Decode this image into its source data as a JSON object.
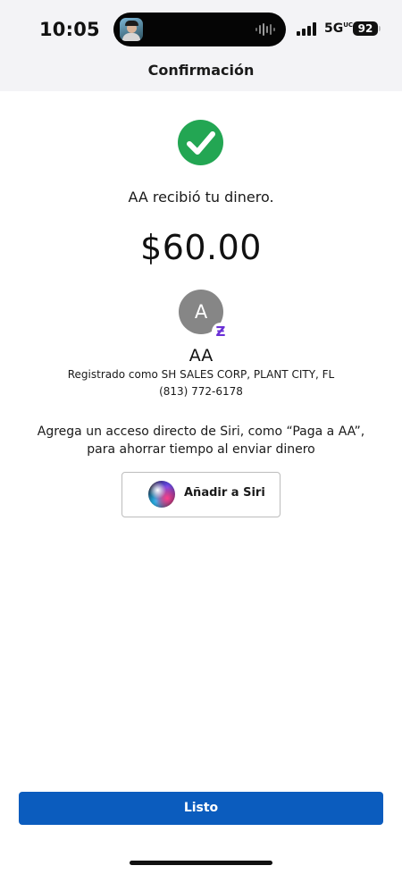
{
  "status_bar": {
    "time": "10:05",
    "network": "5G",
    "network_suffix": "UC",
    "battery_level": "92",
    "icons": [
      "profile-picture-icon",
      "audio-waveform-icon",
      "cellular-signal-icon",
      "battery-icon"
    ]
  },
  "nav": {
    "title": "Confirmación"
  },
  "confirmation": {
    "status_icon": "success-checkmark-icon",
    "message": "AA recibió tu dinero.",
    "amount": "$60.00",
    "accent_color": "#23a653"
  },
  "recipient": {
    "avatar_initial": "A",
    "badge_symbol": "Ƶ",
    "name": "AA",
    "registered": "Registrado como SH SALES CORP, PLANT CITY, FL",
    "phone": "(813) 772-6178",
    "badge_color": "#6a2fd6"
  },
  "siri": {
    "message": "Agrega un acceso directo de Siri, como “Paga a AA”, para ahorrar tiempo al enviar dinero",
    "button_label": "Añadir a Siri",
    "icon": "siri-icon"
  },
  "footer": {
    "done_label": "Listo",
    "button_color": "#0b5cbe"
  }
}
